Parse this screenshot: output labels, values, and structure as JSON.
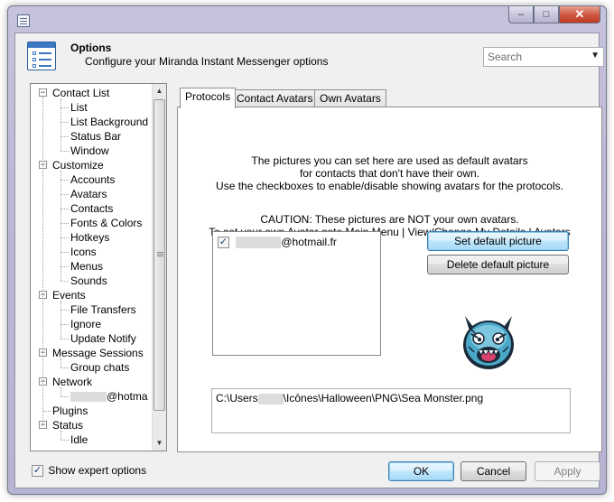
{
  "window": {
    "close_glyph": "✕",
    "minimize_glyph": "–",
    "maximize_glyph": "□"
  },
  "header": {
    "title": "Options",
    "subtitle": "Configure your Miranda Instant Messenger options",
    "search_placeholder": "Search",
    "search_arrow": "▼"
  },
  "tree": {
    "items": [
      {
        "label": "Contact List",
        "level": 0,
        "expanded": true
      },
      {
        "label": "List",
        "level": 1
      },
      {
        "label": "List Background",
        "level": 1
      },
      {
        "label": "Status Bar",
        "level": 1
      },
      {
        "label": "Window",
        "level": 1
      },
      {
        "label": "Customize",
        "level": 0,
        "expanded": true
      },
      {
        "label": "Accounts",
        "level": 1
      },
      {
        "label": "Avatars",
        "level": 1,
        "selected": true
      },
      {
        "label": "Contacts",
        "level": 1
      },
      {
        "label": "Fonts & Colors",
        "level": 1
      },
      {
        "label": "Hotkeys",
        "level": 1
      },
      {
        "label": "Icons",
        "level": 1
      },
      {
        "label": "Menus",
        "level": 1
      },
      {
        "label": "Sounds",
        "level": 1
      },
      {
        "label": "Events",
        "level": 0,
        "expanded": true
      },
      {
        "label": "File Transfers",
        "level": 1
      },
      {
        "label": "Ignore",
        "level": 1
      },
      {
        "label": "Update Notify",
        "level": 1
      },
      {
        "label": "Message Sessions",
        "level": 0,
        "expanded": true
      },
      {
        "label": "Group chats",
        "level": 1
      },
      {
        "label": "Network",
        "level": 0,
        "expanded": true
      },
      {
        "label": "@hotma",
        "level": 1
      },
      {
        "label": "Plugins",
        "level": 0
      },
      {
        "label": "Status",
        "level": 0,
        "expanded": true
      },
      {
        "label": "Idle",
        "level": 1
      }
    ],
    "expand_glyph": "−"
  },
  "tabs": [
    {
      "label": "Protocols",
      "active": true
    },
    {
      "label": "Contact Avatars",
      "active": false
    },
    {
      "label": "Own Avatars",
      "active": false
    }
  ],
  "panel": {
    "info_line1": "The pictures you can set here are used as default avatars",
    "info_line2": "for contacts that don't have their own.",
    "info_line3": "Use the checkboxes to enable/disable showing avatars for the protocols.",
    "caution_line1": "CAUTION: These pictures are NOT your own avatars.",
    "caution_line2": "To set your own Avatar goto Main Menu | View/Change My Details | Avatars",
    "account_suffix": "@hotmail.fr",
    "account_checked": true,
    "check_glyph": "✓",
    "set_default_label": "Set default picture",
    "delete_default_label": "Delete default picture",
    "path_prefix": "C:\\Users",
    "path_suffix": "\\Icônes\\Halloween\\PNG\\Sea Monster.png"
  },
  "footer": {
    "expert_label": "Show expert options",
    "expert_checked": true,
    "ok_label": "OK",
    "cancel_label": "Cancel",
    "apply_label": "Apply"
  }
}
